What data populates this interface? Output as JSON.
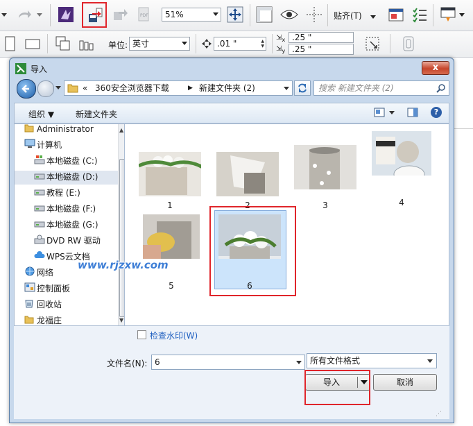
{
  "toolbar": {
    "zoom_value": "51%",
    "snap_label": "贴齐(T)"
  },
  "propbar": {
    "unit_label": "单位:",
    "unit_value": "英寸",
    "nudge_value": ".01 \"",
    "dup_x_value": ".25 \"",
    "dup_y_value": ".25 \""
  },
  "dialog": {
    "title": "导入",
    "close_label": "x",
    "breadcrumb": {
      "prefix": "«",
      "items": [
        "360安全浏览器下载",
        "新建文件夹 (2)"
      ]
    },
    "search_placeholder": "搜索 新建文件夹 (2)",
    "commands": {
      "organize": "组织 ▼",
      "new_folder": "新建文件夹"
    },
    "tree": [
      {
        "label": "Administrator",
        "icon": "user-folder-icon"
      },
      {
        "label": "计算机",
        "icon": "computer-icon"
      },
      {
        "label": "本地磁盘 (C:)",
        "icon": "windows-drive-icon"
      },
      {
        "label": "本地磁盘 (D:)",
        "icon": "drive-icon"
      },
      {
        "label": "教程 (E:)",
        "icon": "drive-icon"
      },
      {
        "label": "本地磁盘 (F:)",
        "icon": "drive-icon"
      },
      {
        "label": "本地磁盘 (G:)",
        "icon": "drive-icon"
      },
      {
        "label": "DVD RW 驱动",
        "icon": "dvd-drive-icon"
      },
      {
        "label": "WPS云文档",
        "icon": "cloud-icon"
      },
      {
        "label": "网络",
        "icon": "network-icon"
      },
      {
        "label": "控制面板",
        "icon": "control-panel-icon"
      },
      {
        "label": "回收站",
        "icon": "recycle-bin-icon"
      },
      {
        "label": "龙福庄",
        "icon": "folder-icon"
      }
    ],
    "files": [
      "1",
      "2",
      "3",
      "4",
      "5",
      "6"
    ],
    "watermark_text": "www.rjzxw.com",
    "checkbox_label": "检查水印(W)",
    "filename_label": "文件名(N):",
    "filename_value": "6",
    "filetype_value": "所有文件格式",
    "import_label": "导入",
    "cancel_label": "取消"
  },
  "colors": {
    "highlight_red": "#e0252b",
    "selection_blue": "#cce4fb",
    "dialog_frame": "#c7d8ec"
  }
}
